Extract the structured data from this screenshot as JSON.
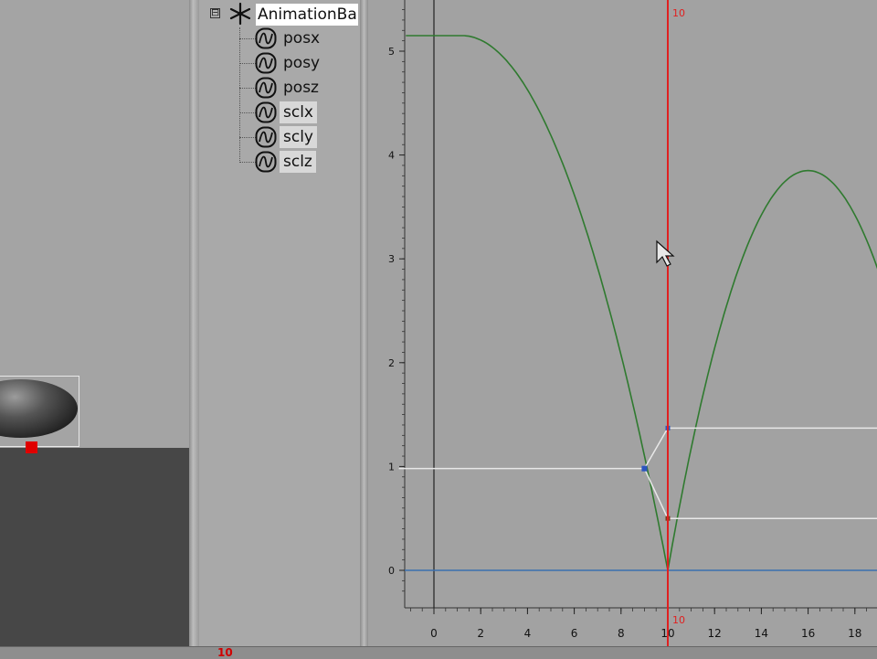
{
  "outliner": {
    "root_label": "AnimationBa",
    "expander_symbol": "⊟",
    "channels": [
      {
        "label": "posx",
        "selected": false
      },
      {
        "label": "posy",
        "selected": false
      },
      {
        "label": "posz",
        "selected": false
      },
      {
        "label": "sclx",
        "selected": true
      },
      {
        "label": "scly",
        "selected": true
      },
      {
        "label": "sclz",
        "selected": true
      }
    ],
    "scroll_left": "◀",
    "scroll_right": "▶"
  },
  "graph": {
    "current_frame_top": "10",
    "current_frame_bottom": "10",
    "y_ticks": [
      "5",
      "4",
      "3",
      "2",
      "1",
      "0"
    ],
    "x_ticks": [
      "0",
      "2",
      "4",
      "6",
      "8",
      "10",
      "12",
      "14",
      "16",
      "18"
    ],
    "colors": {
      "background": "#a2a2a2",
      "curve_green": "#2f7a2f",
      "curve_white": "#e8e8e8",
      "zero_line": "#3a6fb0",
      "time_cursor": "#e02020"
    }
  },
  "timeline": {
    "current": "10"
  }
}
